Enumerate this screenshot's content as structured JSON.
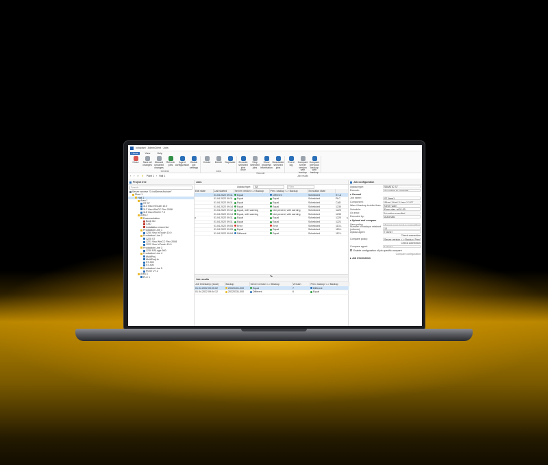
{
  "window": {
    "title": "octoplant · AdminClient · Jobs"
  },
  "ribbon_tabs": [
    "Home",
    "View",
    "Help"
  ],
  "ribbon_groups": [
    {
      "label": "General",
      "buttons": [
        {
          "label": "Close",
          "color": "#d9534f"
        },
        {
          "label": "Save all changes",
          "color": "#9aa3ad"
        },
        {
          "label": "Discard unsaved changes",
          "color": "#9aa3ad"
        },
        {
          "label": "Refresh jobs",
          "color": "#2f8f46"
        },
        {
          "label": "Agent configuration",
          "color": "#2a6fb8"
        },
        {
          "label": "Global job settings",
          "color": "#2a6fb8"
        }
      ]
    },
    {
      "label": "Jobs",
      "buttons": [
        {
          "label": "Create",
          "color": "#9aa3ad"
        },
        {
          "label": "Delete",
          "color": "#9aa3ad"
        },
        {
          "label": "Duplicate",
          "color": "#2a6fb8"
        }
      ]
    },
    {
      "label": "Execute",
      "buttons": [
        {
          "label": "Execute selected jobs once",
          "color": "#2a6fb8"
        },
        {
          "label": "Stop selected jobs",
          "color": "#9aa3ad"
        },
        {
          "label": "Show progress information",
          "color": "#2a6fb8"
        },
        {
          "label": "Deactivate selected jobs",
          "color": "#2a6fb8"
        }
      ]
    },
    {
      "label": "Job results",
      "buttons": [
        {
          "label": "Event log",
          "color": "#2a6fb8"
        },
        {
          "label": "Compare server version with backup",
          "color": "#9aa3ad"
        },
        {
          "label": "Compare previous backup with backup",
          "color": "#2a6fb8"
        }
      ]
    }
  ],
  "breadcrumb": [
    "Plant 1",
    "Hall 1"
  ],
  "tree": {
    "title": "Project tree",
    "search_placeholder": "Search",
    "nodes": [
      {
        "label": "Server archive \"D:\\vdServerArchive\"",
        "indent": 0,
        "color": "#6b7a8c"
      },
      {
        "label": "Plant 1",
        "indent": 1,
        "color": "#e8b829"
      },
      {
        "label": "Hall 1",
        "indent": 2,
        "color": "#e8b829",
        "selected": true
      },
      {
        "label": "Area 1",
        "indent": 3,
        "color": "#e8b829"
      },
      {
        "label": "S7 S7",
        "indent": 4,
        "color": "#2a6fb8"
      },
      {
        "label": "113 Viso InTouch 10.0",
        "indent": 4,
        "color": "#2a6fb8"
      },
      {
        "label": "112 Viso WinCC Flex 2008",
        "indent": 4,
        "color": "#2a6fb8"
      },
      {
        "label": "115 Viso WinCC 7.0",
        "indent": 4,
        "color": "#2a6fb8"
      },
      {
        "label": "Area 2",
        "indent": 3,
        "color": "#e8b829"
      },
      {
        "label": "Documentation",
        "indent": 4,
        "color": "#e8b829"
      },
      {
        "label": "Book list",
        "indent": 5,
        "color": "#c0392b"
      },
      {
        "label": "CAD",
        "indent": 5,
        "color": "#c0392b"
      },
      {
        "label": "Installation check list",
        "indent": 5,
        "color": "#c0392b"
      },
      {
        "label": "Production Line 1",
        "indent": 4,
        "color": "#e8b829"
      },
      {
        "label": "1230 Viso InTouch 10.0",
        "indent": 5,
        "color": "#2a6fb8"
      },
      {
        "label": "Production Line 2",
        "indent": 4,
        "color": "#e8b829"
      },
      {
        "label": "1220 S7",
        "indent": 5,
        "color": "#2a6fb8"
      },
      {
        "label": "1221 Viso WinCC Flex 2008",
        "indent": 5,
        "color": "#2a6fb8"
      },
      {
        "label": "1222 Viso InTouch 10.0",
        "indent": 5,
        "color": "#2a6fb8"
      },
      {
        "label": "Production Line 3",
        "indent": 4,
        "color": "#e8b829"
      },
      {
        "label": "1230 RSLogix 500",
        "indent": 5,
        "color": "#2a6fb8"
      },
      {
        "label": "Production Line 4",
        "indent": 4,
        "color": "#e8b829"
      },
      {
        "label": "MultiProj",
        "indent": 5,
        "color": "#2a6fb8"
      },
      {
        "label": "MultiProjLib",
        "indent": 5,
        "color": "#2a6fb8"
      },
      {
        "label": "S7-300",
        "indent": 5,
        "color": "#2a6fb8"
      },
      {
        "label": "S7-400",
        "indent": 5,
        "color": "#2a6fb8"
      },
      {
        "label": "Production Line 5",
        "indent": 4,
        "color": "#e8b829"
      },
      {
        "label": "PCS7 V7.1",
        "indent": 5,
        "color": "#2a6fb8"
      },
      {
        "label": "Area 3",
        "indent": 3,
        "color": "#e8b829"
      },
      {
        "label": "PLC 1",
        "indent": 4,
        "color": "#2a6fb8"
      }
    ]
  },
  "jobs": {
    "title": "Jobs",
    "upload_type_label": "Upload type:",
    "upload_type_value": "All",
    "filter_placeholder": "Filter",
    "columns": [
      "Edit state",
      "Last started",
      "Server version <-> Backup",
      "Prev. backup <-> Backup",
      "Execution state",
      ""
    ],
    "rows": [
      {
        "started": "01.04.2022 09:11",
        "srv": "Equal",
        "srv_color": "#2f9e44",
        "prev": "Different",
        "prev_color": "#2a6fb8",
        "exec": "Scheduled",
        "comp": "S7-A",
        "selected": true
      },
      {
        "started": "01.04.2022 09:11",
        "srv": "Equal",
        "srv_color": "#2f9e44",
        "prev": "Equal",
        "prev_color": "#2f9e44",
        "exec": "Scheduled",
        "comp": "PLC",
        "selected": false
      },
      {
        "started": "01.04.2022 09:11",
        "srv": "Equal",
        "srv_color": "#2f9e44",
        "prev": "Equal",
        "prev_color": "#2f9e44",
        "exec": "Scheduled",
        "comp": "CAD",
        "selected": false
      },
      {
        "started": "01.04.2022 09:14",
        "srv": "Equal",
        "srv_color": "#2f9e44",
        "prev": "Equal",
        "prev_color": "#2f9e44",
        "exec": "Scheduled",
        "comp": "1230",
        "selected": false
      },
      {
        "started": "01.04.2022 09:12",
        "srv": "Equal, with warning",
        "srv_color": "#2f9e44",
        "prev": "Not present, with warning",
        "prev_color": "#2f9e44",
        "exec": "Scheduled",
        "comp": "1222",
        "selected": false
      },
      {
        "started": "01.04.2022 09:14",
        "srv": "Equal, with warning",
        "srv_color": "#2f9e44",
        "prev": "Not present, with warning",
        "prev_color": "#2f9e44",
        "exec": "Scheduled",
        "comp": "1230",
        "selected": false
      },
      {
        "started": "01.04.2022 09:11",
        "srv": "Equal",
        "srv_color": "#2f9e44",
        "prev": "Equal",
        "prev_color": "#2f9e44",
        "exec": "Scheduled",
        "comp": "1220",
        "selected": false
      },
      {
        "started": "01.04.2022 09:11",
        "srv": "Equal",
        "srv_color": "#2f9e44",
        "prev": "Equal",
        "prev_color": "#2f9e44",
        "exec": "Scheduled",
        "comp": "1221",
        "selected": false
      },
      {
        "started": "01.04.2022 09:05",
        "srv": "Error",
        "srv_color": "#d9342b",
        "prev": "Error",
        "prev_color": "#d9342b",
        "exec": "Scheduled",
        "comp": "113 L",
        "selected": false
      },
      {
        "started": "01.04.2022 09:05",
        "srv": "Equal",
        "srv_color": "#2f9e44",
        "prev": "Equal",
        "prev_color": "#2f9e44",
        "exec": "Scheduled",
        "comp": "115 L",
        "selected": false
      },
      {
        "started": "01.04.2022 09:04",
        "srv": "Different",
        "srv_color": "#2a6fb8",
        "prev": "Equal",
        "prev_color": "#2f9e44",
        "exec": "Scheduled",
        "comp": "112 L",
        "selected": false
      }
    ]
  },
  "job_results": {
    "title": "Job results",
    "columns": [
      "Job timestamp (local)",
      "Backup",
      "Server version <-> Backup",
      "Version",
      "Prev. backup <-> Backup"
    ],
    "rows": [
      {
        "ts": "01.04.2022 09:05:02",
        "backup": "20220401-000",
        "srv": "Equal",
        "srv_color": "#2f9e44",
        "version": "7",
        "prev": "Different",
        "prev_color": "#2a6fb8",
        "selected": true
      },
      {
        "ts": "01.04.2022 09:04:12",
        "backup": "20220331-000",
        "srv": "Different",
        "srv_color": "#2a6fb8",
        "version": "6",
        "prev": "Equal",
        "prev_color": "#2f9e44",
        "selected": false
      }
    ]
  },
  "job_config": {
    "title": "Job configuration",
    "fields_top": [
      {
        "label": "Upload type:",
        "value": "SIMATIC S7"
      },
      {
        "label": "Execute:",
        "value": "According to schedule"
      }
    ],
    "general_title": "General",
    "general_fields": [
      {
        "label": "Job name:",
        "value": "S7-Area1"
      },
      {
        "label": "Component:",
        "value": "\\Plant 1\\Hall 1\\Area 1\\1\\S7"
      },
      {
        "label": "Warn if backup is older than:",
        "value": "Never warn"
      },
      {
        "label": "Schedule:",
        "value": "Every day, at 01:30"
      },
      {
        "label": "On error:",
        "value": "No action specified"
      },
      {
        "label": "Executed by:",
        "value": "Automatic"
      }
    ],
    "upload_title": "Upload and compare",
    "upload_fields": [
      {
        "label": "Save policy:",
        "value": "Always save backup (overwriting"
      },
      {
        "label": "Number of backups retained (rollover):",
        "value": "10"
      },
      {
        "label": "Upload agent:",
        "value": "[ None ]"
      },
      {
        "label": "Compare policy:",
        "value": "Server version <-> Backup, Prev."
      },
      {
        "label": "Compare agent:",
        "value": "[ None ]"
      }
    ],
    "check_connection": "Check connection",
    "enable_config_label": "Enable configuration of job-specific compare",
    "compare_config": "Compare configuration",
    "job_information_title": "Job information"
  }
}
